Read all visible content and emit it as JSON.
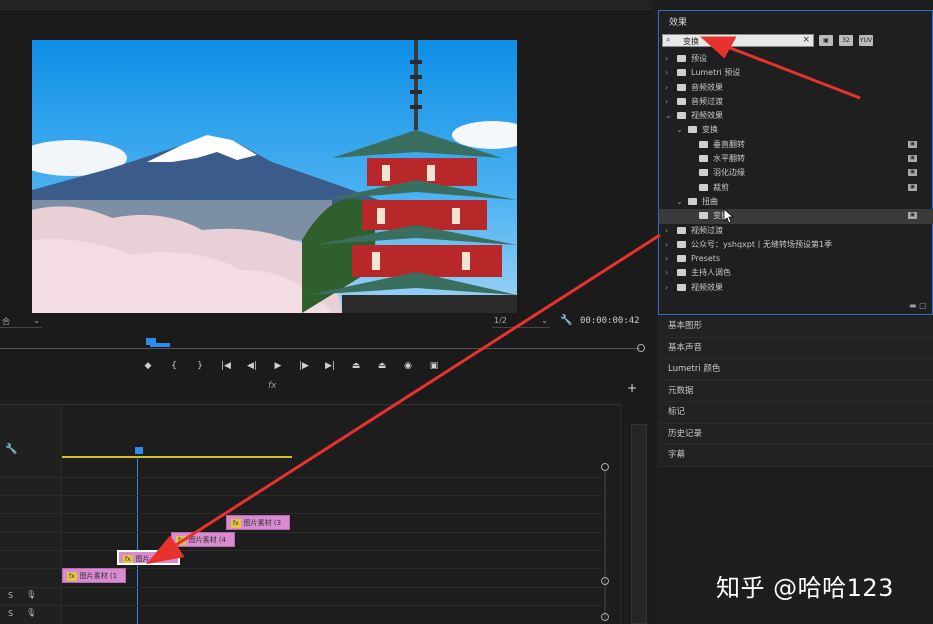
{
  "program_monitor": {
    "fit_label": "合",
    "resolution": "1/2",
    "timecode": "00:00:00:42",
    "fx_label": "fx"
  },
  "transport_icons": [
    "marker-icon",
    "mark-in-icon",
    "mark-out-icon",
    "go-to-in-icon",
    "step-back-icon",
    "play-icon",
    "step-forward-icon",
    "go-to-out-icon",
    "lift-icon",
    "extract-icon",
    "camera-icon",
    "compare-icon"
  ],
  "effects_panel": {
    "title": "效果",
    "search_value": "变换",
    "tree": [
      {
        "label": "预设",
        "indent": 0,
        "type": "folder",
        "expanded": false
      },
      {
        "label": "Lumetri 预设",
        "indent": 0,
        "type": "folder",
        "expanded": false
      },
      {
        "label": "音频效果",
        "indent": 0,
        "type": "folder",
        "expanded": false
      },
      {
        "label": "音频过渡",
        "indent": 0,
        "type": "folder",
        "expanded": false
      },
      {
        "label": "视频效果",
        "indent": 0,
        "type": "folder",
        "expanded": true
      },
      {
        "label": "变换",
        "indent": 1,
        "type": "folder",
        "expanded": true
      },
      {
        "label": "垂直翻转",
        "indent": 2,
        "type": "effect",
        "badge": true
      },
      {
        "label": "水平翻转",
        "indent": 2,
        "type": "effect",
        "badge": true
      },
      {
        "label": "羽化边缘",
        "indent": 2,
        "type": "effect",
        "badge": true
      },
      {
        "label": "裁剪",
        "indent": 2,
        "type": "effect",
        "badge": true
      },
      {
        "label": "扭曲",
        "indent": 1,
        "type": "folder",
        "expanded": true
      },
      {
        "label": "变换",
        "indent": 2,
        "type": "effect",
        "badge": true,
        "highlight": true
      },
      {
        "label": "视频过渡",
        "indent": 0,
        "type": "folder",
        "expanded": false
      },
      {
        "label": "公众号：yshqxpt丨无缝转场预设第1季",
        "indent": 0,
        "type": "folder",
        "expanded": false
      },
      {
        "label": "Presets",
        "indent": 0,
        "type": "folder",
        "expanded": false
      },
      {
        "label": "主持人调色",
        "indent": 0,
        "type": "folder",
        "expanded": false
      },
      {
        "label": "视频效果",
        "indent": 0,
        "type": "folder",
        "expanded": false
      }
    ]
  },
  "side_panels": [
    "基本图形",
    "基本声音",
    "Lumetri 颜色",
    "元数据",
    "标记",
    "历史记录",
    "字幕"
  ],
  "timeline": {
    "clips": [
      {
        "label": "图片素材 (3",
        "fx": "fx"
      },
      {
        "label": "图片素材 (4",
        "fx": "fx"
      },
      {
        "label": "图片",
        "fx": "fx"
      },
      {
        "label": "图片素材 (1",
        "fx": "fx"
      }
    ],
    "audio_tracks": [
      {
        "label": "S"
      },
      {
        "label": "S"
      }
    ]
  },
  "watermark": "知乎 @哈哈123",
  "colors": {
    "accent_blue": "#2d8ceb",
    "clip_pink": "#d98bd0",
    "arrow_red": "#e8322d"
  }
}
